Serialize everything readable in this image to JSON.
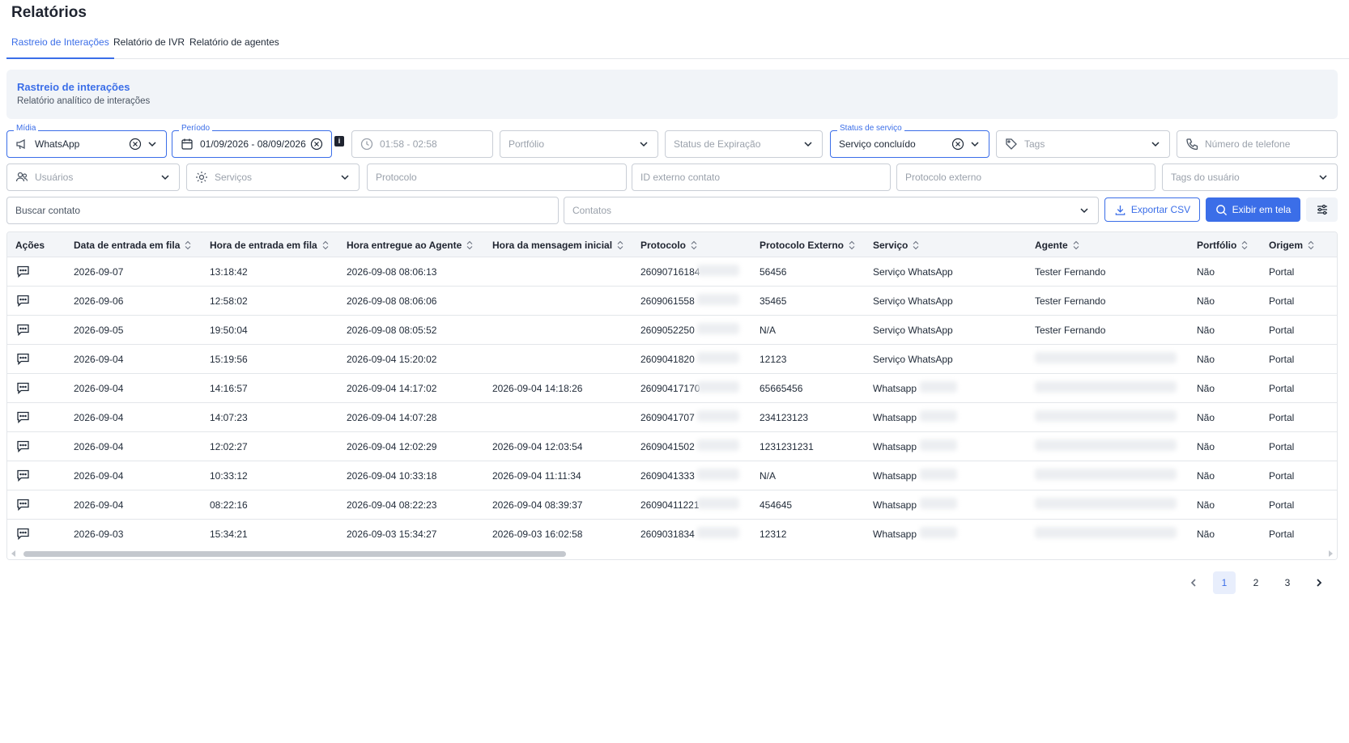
{
  "page": {
    "title": "Relatórios"
  },
  "tabs": [
    {
      "label": "Rastreio de Interações",
      "active": true
    },
    {
      "label": "Relatório de IVR",
      "active": false
    },
    {
      "label": "Relatório de agentes",
      "active": false
    }
  ],
  "banner": {
    "title": "Rastreio de interações",
    "subtitle": "Relatório analítico de interações"
  },
  "filters": {
    "midia": {
      "label": "Mídia",
      "value": "WhatsApp",
      "icon": "megaphone-icon"
    },
    "periodo": {
      "label": "Período",
      "value": "01/09/2026 - 08/09/2026",
      "icon": "calendar-icon",
      "info": "i"
    },
    "hora": {
      "placeholder": "01:58 - 02:58",
      "icon": "clock-icon"
    },
    "portfolio": {
      "placeholder": "Portfólio"
    },
    "status_expiracao": {
      "placeholder": "Status de Expiração"
    },
    "status_servico": {
      "label": "Status de serviço",
      "value": "Serviço concluído"
    },
    "tags": {
      "placeholder": "Tags",
      "icon": "tag-icon"
    },
    "telefone": {
      "placeholder": "Número de telefone",
      "icon": "phone-icon"
    },
    "usuarios": {
      "placeholder": "Usuários",
      "icon": "users-icon"
    },
    "servicos": {
      "placeholder": "Serviços",
      "icon": "gear-icon"
    },
    "protocolo": {
      "placeholder": "Protocolo"
    },
    "id_externo": {
      "placeholder": "ID externo contato"
    },
    "protocolo_externo": {
      "placeholder": "Protocolo externo"
    },
    "tags_usuario": {
      "placeholder": "Tags do usuário"
    },
    "buscar_contato": {
      "placeholder": "Buscar contato"
    },
    "contatos": {
      "placeholder": "Contatos"
    }
  },
  "actions": {
    "export_csv": "Exportar CSV",
    "show_screen": "Exibir em tela"
  },
  "colors": {
    "accent": "#3b6ee8",
    "banner_bg": "#f1f4f8",
    "header_bg": "#f3f5f8"
  },
  "table": {
    "headers": [
      "Ações",
      "Data de entrada em fila",
      "Hora de entrada em fila",
      "Hora entregue ao Agente",
      "Hora da mensagem inicial",
      "Protocolo",
      "Protocolo Externo",
      "Serviço",
      "Agente",
      "Portfólio",
      "Origem"
    ],
    "rows": [
      {
        "data": "2026-09-07",
        "hora": "13:18:42",
        "entregue": "2026-09-08 08:06:13",
        "inicial": "",
        "protocolo": "260907161­84",
        "externo": "56456",
        "servico": "Serviço WhatsApp",
        "agente": "Tester Fernando",
        "portfolio": "Não",
        "origem": "Portal"
      },
      {
        "data": "2026-09-06",
        "hora": "12:58:02",
        "entregue": "2026-09-08 08:06:06",
        "inicial": "",
        "protocolo": "260906155­8",
        "externo": "35465",
        "servico": "Serviço WhatsApp",
        "agente": "Tester Fernando",
        "portfolio": "Não",
        "origem": "Portal"
      },
      {
        "data": "2026-09-05",
        "hora": "19:50:04",
        "entregue": "2026-09-08 08:05:52",
        "inicial": "",
        "protocolo": "2609052250",
        "externo": "N/A",
        "servico": "Serviço WhatsApp",
        "agente": "Tester Fernando",
        "portfolio": "Não",
        "origem": "Portal"
      },
      {
        "data": "2026-09-04",
        "hora": "15:19:56",
        "entregue": "2026-09-04 15:20:02",
        "inicial": "",
        "protocolo": "2609041820",
        "externo": "12123",
        "servico": "Serviço WhatsApp",
        "agente": "",
        "portfolio": "Não",
        "origem": "Portal"
      },
      {
        "data": "2026-09-04",
        "hora": "14:16:57",
        "entregue": "2026-09-04 14:17:02",
        "inicial": "2026-09-04 14:18:26",
        "protocolo": "260904171­70",
        "externo": "65665456",
        "servico": "Whatsapp",
        "agente": "",
        "portfolio": "Não",
        "origem": "Portal"
      },
      {
        "data": "2026-09-04",
        "hora": "14:07:23",
        "entregue": "2026-09-04 14:07:28",
        "inicial": "",
        "protocolo": "260904170­7",
        "externo": "234123123",
        "servico": "Whatsapp",
        "agente": "",
        "portfolio": "Não",
        "origem": "Portal"
      },
      {
        "data": "2026-09-04",
        "hora": "12:02:27",
        "entregue": "2026-09-04 12:02:29",
        "inicial": "2026-09-04 12:03:54",
        "protocolo": "2609041502",
        "externo": "1231231231",
        "servico": "Whatsapp",
        "agente": "",
        "portfolio": "Não",
        "origem": "Portal"
      },
      {
        "data": "2026-09-04",
        "hora": "10:33:12",
        "entregue": "2026-09-04 10:33:18",
        "inicial": "2026-09-04 11:11:34",
        "protocolo": "2609041333",
        "externo": "N/A",
        "servico": "Whatsapp",
        "agente": "",
        "portfolio": "Não",
        "origem": "Portal"
      },
      {
        "data": "2026-09-04",
        "hora": "08:22:16",
        "entregue": "2026-09-04 08:22:23",
        "inicial": "2026-09-04 08:39:37",
        "protocolo": "2609041122­1",
        "externo": "454645",
        "servico": "Whatsapp",
        "agente": "",
        "portfolio": "Não",
        "origem": "Portal"
      },
      {
        "data": "2026-09-03",
        "hora": "15:34:21",
        "entregue": "2026-09-03 15:34:27",
        "inicial": "2026-09-03 16:02:58",
        "protocolo": "2609031834",
        "externo": "12312",
        "servico": "Whatsapp",
        "agente": "",
        "portfolio": "Não",
        "origem": "Portal"
      }
    ]
  },
  "pagination": {
    "pages": [
      "1",
      "2",
      "3"
    ],
    "current": "1"
  }
}
